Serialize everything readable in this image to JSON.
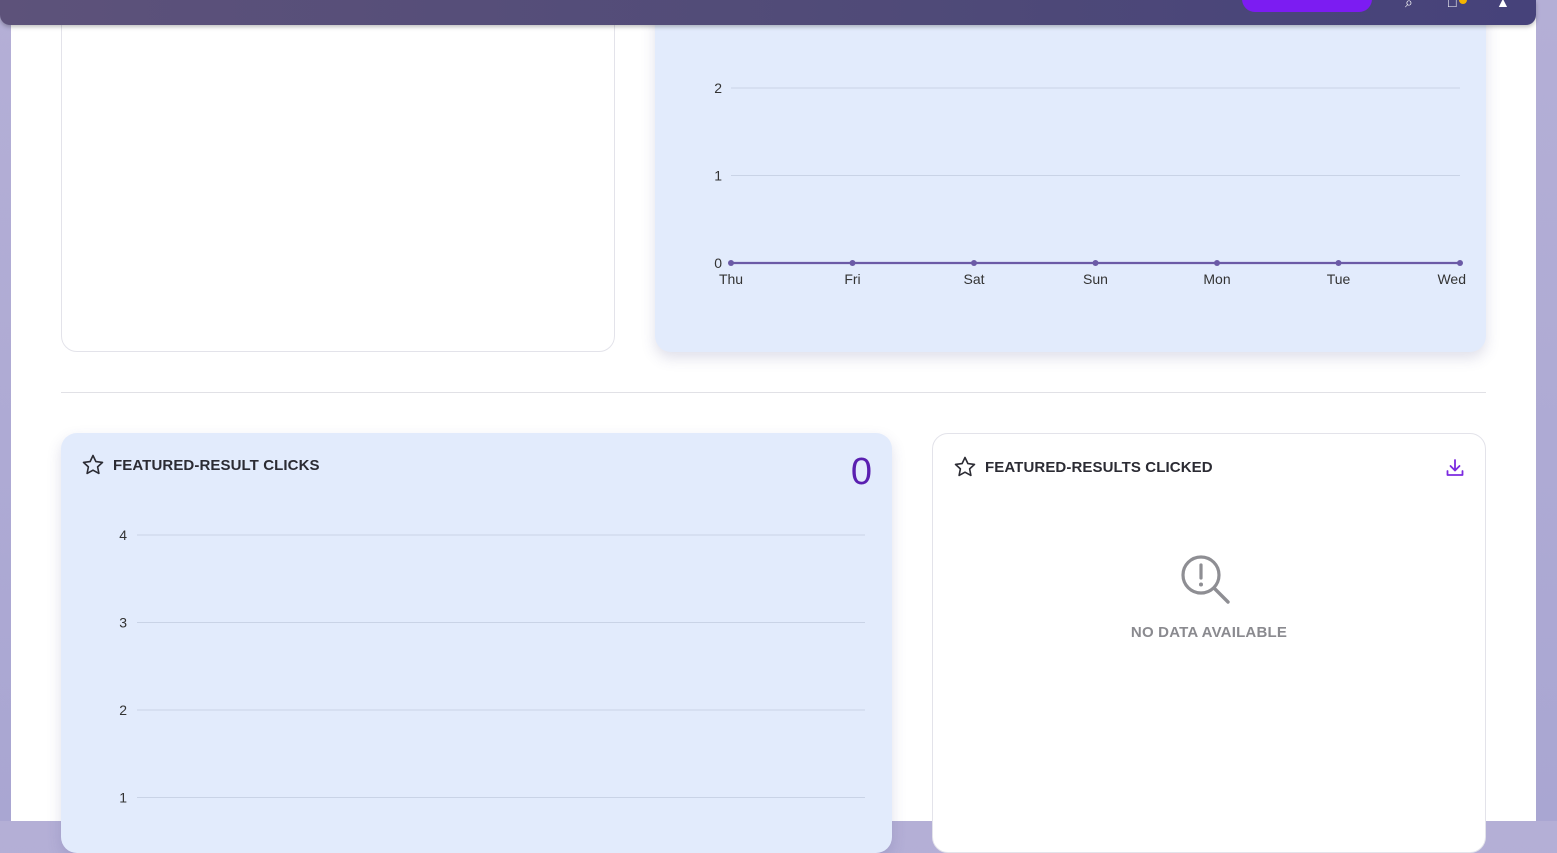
{
  "topbar": {
    "icons": [
      "search-icon",
      "notification-icon",
      "cart-icon"
    ],
    "accent": "#7c1cf2"
  },
  "top_chart": {
    "chart_data": {
      "type": "line",
      "categories": [
        "Thu",
        "Fri",
        "Sat",
        "Sun",
        "Mon",
        "Tue",
        "Wed"
      ],
      "values": [
        0,
        0,
        0,
        0,
        0,
        0,
        0
      ],
      "yticks": [
        "0",
        "1",
        "2"
      ],
      "color": "#6b5aa6"
    }
  },
  "featured_clicks": {
    "title": "FEATURED-RESULT CLICKS",
    "value": "0",
    "icon": "star-icon",
    "chart_data": {
      "type": "line",
      "categories": [],
      "values": [],
      "yticks": [
        "1",
        "2",
        "3",
        "4"
      ]
    }
  },
  "featured_clicked": {
    "title": "FEATURED-RESULTS CLICKED",
    "icon": "star-icon",
    "action_icon": "download-icon",
    "empty_icon": "search-alert-icon",
    "empty_text": "NO DATA AVAILABLE"
  }
}
